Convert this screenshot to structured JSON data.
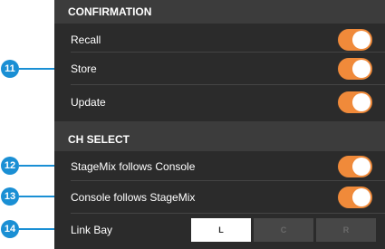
{
  "confirmation": {
    "header": "CONFIRMATION",
    "items": [
      {
        "label": "Recall",
        "state": "on"
      },
      {
        "label": "Store",
        "state": "on"
      },
      {
        "label": "Update",
        "state": "on"
      }
    ]
  },
  "ch_select": {
    "header": "CH SELECT",
    "items": [
      {
        "label": "StageMix follows Console",
        "state": "on"
      },
      {
        "label": "Console follows StageMix",
        "state": "on"
      }
    ],
    "link_bay": {
      "label": "Link Bay",
      "options": [
        "L",
        "C",
        "R"
      ],
      "selected": "L"
    }
  },
  "callouts": [
    "11",
    "12",
    "13",
    "14"
  ],
  "colors": {
    "panel_bg": "#2b2b2b",
    "header_bg": "#3c3c3c",
    "toggle_on": "#f08a3a",
    "callout": "#1a8fd4"
  }
}
